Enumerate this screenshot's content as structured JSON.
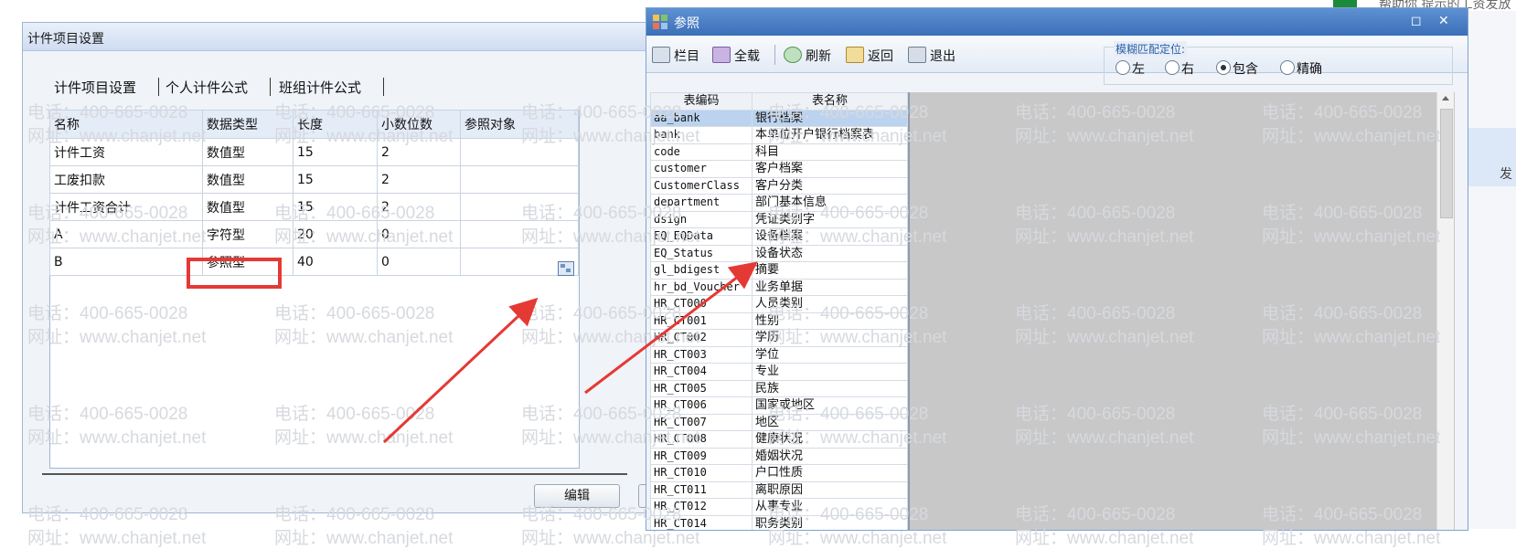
{
  "background": {
    "top_text": "帮助你 提示的工资发放",
    "side_text": "发"
  },
  "dialog1": {
    "title": "计件项目设置",
    "tabs": [
      "计件项目设置",
      "个人计件公式",
      "班组计件公式"
    ],
    "columns": [
      "名称",
      "数据类型",
      "长度",
      "小数位数",
      "参照对象"
    ],
    "rows": [
      [
        "计件工资",
        "数值型",
        "15",
        "2",
        ""
      ],
      [
        "工废扣款",
        "数值型",
        "15",
        "2",
        ""
      ],
      [
        "计件工资合计",
        "数值型",
        "15",
        "2",
        ""
      ],
      [
        "A",
        "字符型",
        "20",
        "0",
        ""
      ],
      [
        "B",
        "参照型",
        "40",
        "0",
        ""
      ]
    ],
    "edit_button": "编辑"
  },
  "dialog2": {
    "title": "参照",
    "toolbar": {
      "columns": "栏目",
      "load_all": "全载",
      "refresh": "刷新",
      "back": "返回",
      "exit": "退出"
    },
    "fuzzy": {
      "legend": "模糊匹配定位:",
      "options": [
        "左",
        "右",
        "包含",
        "精确"
      ],
      "selected": "包含"
    },
    "columns": [
      "表编码",
      "表名称"
    ],
    "rows": [
      [
        "aa_bank",
        "银行档案"
      ],
      [
        "bank",
        "本单位开户银行档案表"
      ],
      [
        "code",
        "科目"
      ],
      [
        "customer",
        "客户档案"
      ],
      [
        "CustomerClass",
        "客户分类"
      ],
      [
        "department",
        "部门基本信息"
      ],
      [
        "dsign",
        "凭证类别字"
      ],
      [
        "EQ_EQData",
        "设备档案"
      ],
      [
        "EQ_Status",
        "设备状态"
      ],
      [
        "gl_bdigest",
        "摘要"
      ],
      [
        "hr_bd_Voucher",
        "业务单据"
      ],
      [
        "HR_CT000",
        "人员类别"
      ],
      [
        "HR_CT001",
        "性别"
      ],
      [
        "HR_CT002",
        "学历"
      ],
      [
        "HR_CT003",
        "学位"
      ],
      [
        "HR_CT004",
        "专业"
      ],
      [
        "HR_CT005",
        "民族"
      ],
      [
        "HR_CT006",
        "国家或地区"
      ],
      [
        "HR_CT007",
        "地区"
      ],
      [
        "HR_CT008",
        "健康状况"
      ],
      [
        "HR_CT009",
        "婚姻状况"
      ],
      [
        "HR_CT010",
        "户口性质"
      ],
      [
        "HR_CT011",
        "离职原因"
      ],
      [
        "HR_CT012",
        "从事专业"
      ],
      [
        "HR_CT014",
        "职务类别"
      ]
    ],
    "selected_row": 0
  },
  "watermark": {
    "phone": "电话：400-665-0028",
    "site": "网址：www.chanjet.net"
  },
  "colors": {
    "highlight_red": "#e53935",
    "title_blue": "#3a70b8",
    "selected_row": "#bcd3f0"
  }
}
